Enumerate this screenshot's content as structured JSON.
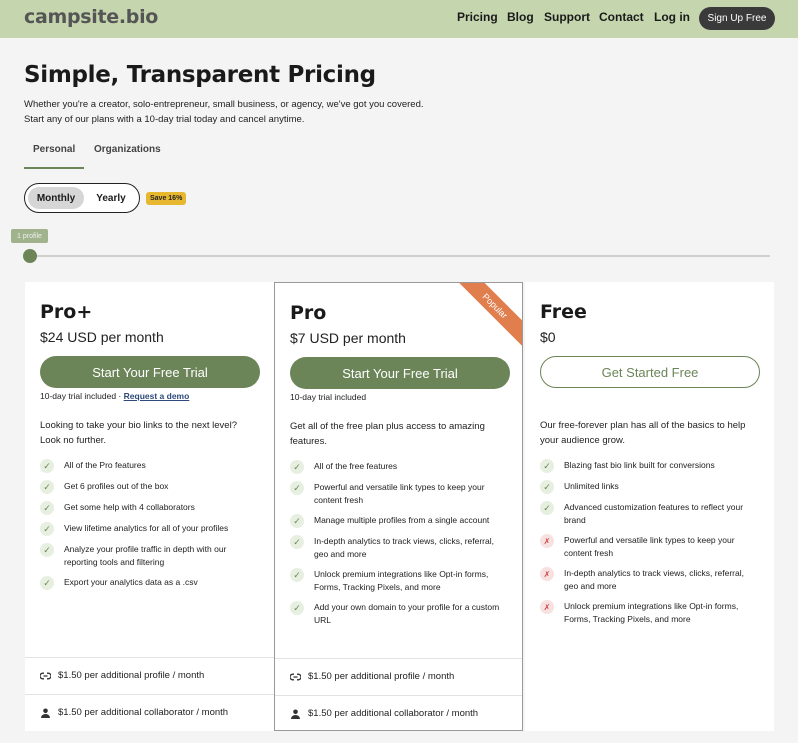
{
  "header": {
    "logo": "campsite.bio",
    "nav": [
      "Pricing",
      "Blog",
      "Support",
      "Contact",
      "Log in"
    ],
    "signup": "Sign Up Free"
  },
  "intro": {
    "title": "Simple, Transparent Pricing",
    "subtitle": "Whether you're a creator, solo-entrepreneur, small business, or agency, we've got you covered. Start any of our plans with a 10-day trial today and cancel anytime.",
    "tabs": [
      "Personal",
      "Organizations"
    ],
    "active_tab": "Personal"
  },
  "billing": {
    "monthly": "Monthly",
    "yearly": "Yearly",
    "selected": "Monthly",
    "save_badge": "Save 16%"
  },
  "slider": {
    "label": "1 profile",
    "value_fraction": 0
  },
  "plans": [
    {
      "name": "Pro+",
      "price": "$24",
      "price_unit": "USD per month",
      "cta": "Start Your Free Trial",
      "trial_note": "10-day trial included ·",
      "demo_link": "Request a demo",
      "description": "Looking to take your bio links to the next level? Look no further.",
      "features": [
        {
          "text": "All of the Pro features",
          "included": true
        },
        {
          "text": "Get 6 profiles out of the box",
          "included": true
        },
        {
          "text": "Get some help with 4 collaborators",
          "included": true
        },
        {
          "text": "View lifetime analytics for all of your profiles",
          "included": true
        },
        {
          "text": "Analyze your profile traffic in depth with our reporting tools and filtering",
          "included": true
        },
        {
          "text": "Export your analytics data as a .csv",
          "included": true
        }
      ],
      "addons": [
        "$1.50 per additional profile / month",
        "$1.50 per additional collaborator / month"
      ]
    },
    {
      "name": "Pro",
      "price": "$7",
      "price_unit": "USD per month",
      "cta": "Start Your Free Trial",
      "trial_note": "10-day trial included",
      "badge": "Popular",
      "description": "Get all of the free plan plus access to amazing features.",
      "features": [
        {
          "text": "All of the free features",
          "included": true
        },
        {
          "text": "Powerful and versatile link types to keep your content fresh",
          "included": true
        },
        {
          "text": "Manage multiple profiles from a single account",
          "included": true
        },
        {
          "text": "In-depth analytics to track views, clicks, referral, geo and more",
          "included": true
        },
        {
          "text": "Unlock premium integrations like Opt-in forms, Forms, Tracking Pixels, and more",
          "included": true
        },
        {
          "text": "Add your own domain to your profile for a custom URL",
          "included": true
        }
      ],
      "addons": [
        "$1.50 per additional profile / month",
        "$1.50 per additional collaborator / month"
      ]
    },
    {
      "name": "Free",
      "price": "$0",
      "cta": "Get Started Free",
      "description": "Our free-forever plan has all of the basics to help your audience grow.",
      "features": [
        {
          "text": "Blazing fast bio link built for conversions",
          "included": true
        },
        {
          "text": "Unlimited links",
          "included": true
        },
        {
          "text": "Advanced customization features to reflect your brand",
          "included": true
        },
        {
          "text": "Powerful and versatile link types to keep your content fresh",
          "included": false
        },
        {
          "text": "In-depth analytics to track views, clicks, referral, geo and more",
          "included": false
        },
        {
          "text": "Unlock premium integrations like Opt-in forms, Forms, Tracking Pixels, and more",
          "included": false
        }
      ]
    }
  ],
  "colors": {
    "header_bg": "#c5d6ae",
    "accent_green": "#6b8558",
    "badge_orange": "#e07e4e",
    "save_yellow": "#e8b730"
  }
}
